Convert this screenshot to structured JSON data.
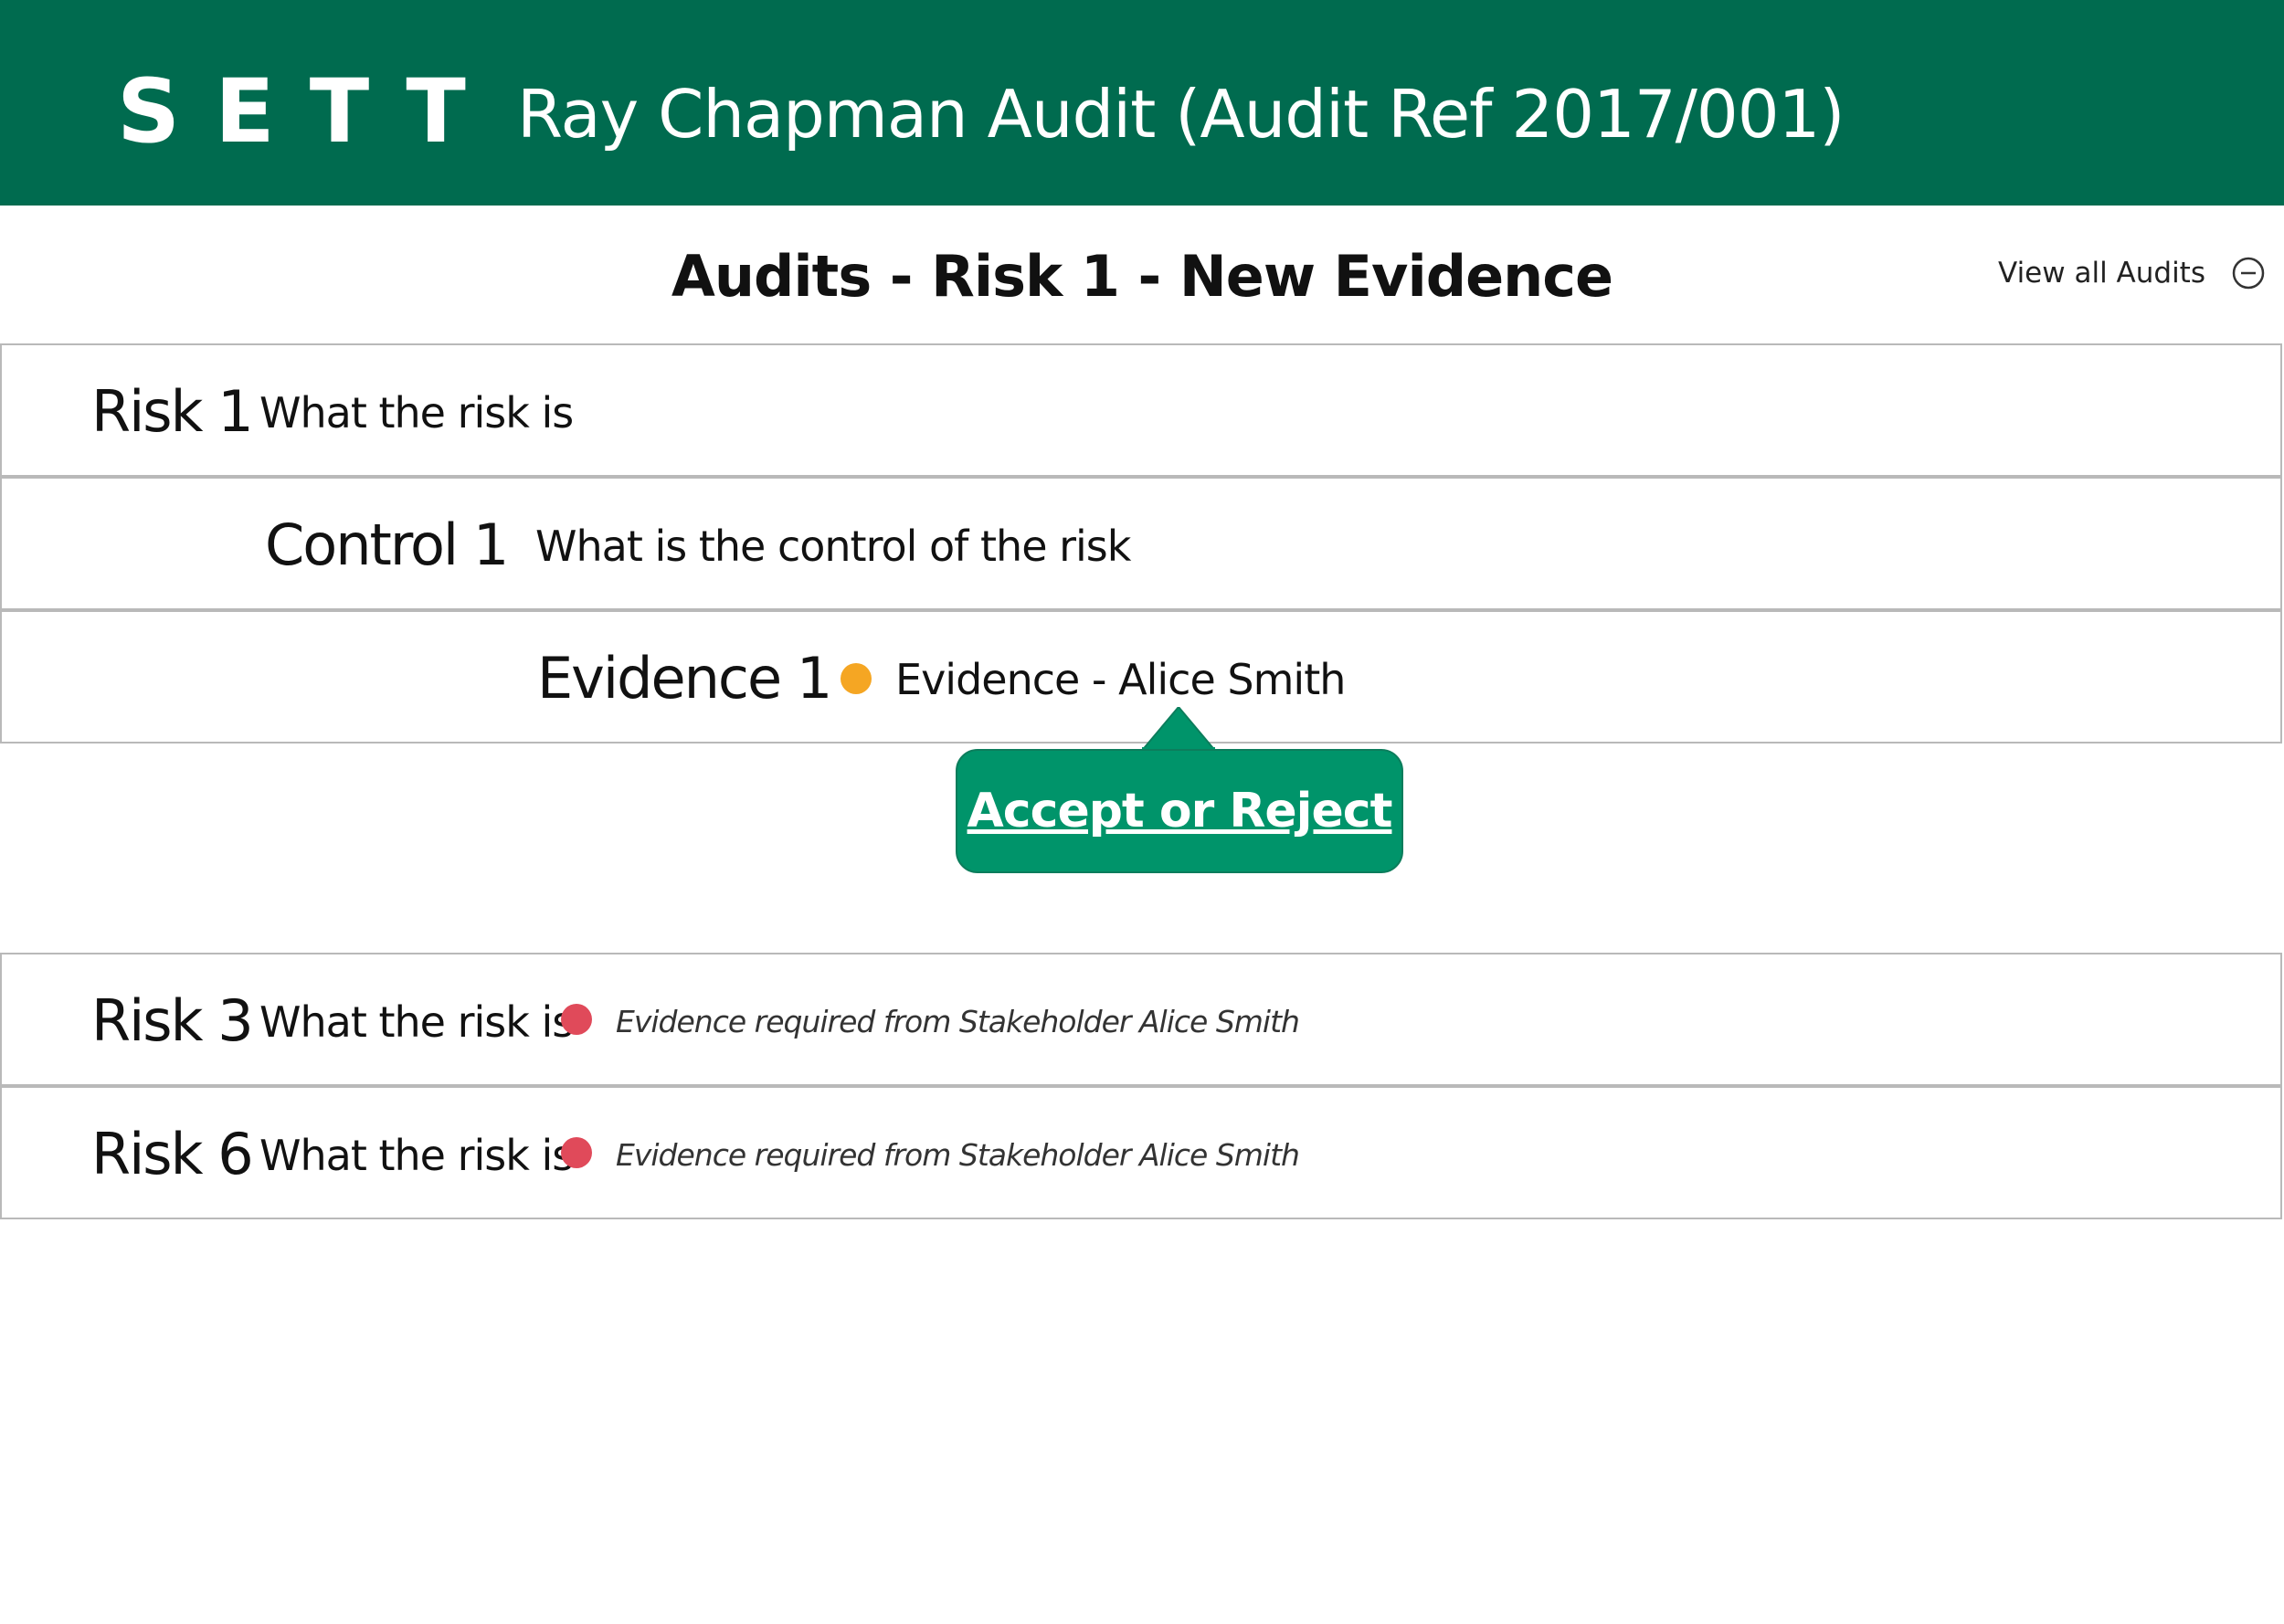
{
  "header": {
    "brand": "SETT",
    "audit_title": "Ray Chapman Audit (Audit Ref 2017/001)",
    "background_color": "#006b4f"
  },
  "page": {
    "title": "Audits - Risk 1 - New Evidence",
    "view_all_label": "View all Audits",
    "view_all_icon": "minus-circle-icon"
  },
  "rows": {
    "risk1": {
      "label": "Risk 1",
      "text": "What the risk is"
    },
    "control1": {
      "label": "Control 1",
      "text": "What is the control of the risk"
    },
    "evidence1": {
      "label": "Evidence 1",
      "status_color": "#f5a623",
      "text": "Evidence - Alice Smith"
    },
    "risk3": {
      "label": "Risk 3",
      "text": "What the risk is",
      "status_color": "#e04a5a",
      "note": "Evidence required from Stakeholder Alice Smith"
    },
    "risk6": {
      "label": "Risk 6",
      "text": "What the risk is",
      "status_color": "#e04a5a",
      "note": "Evidence required from Stakeholder Alice Smith"
    }
  },
  "callout": {
    "label": "Accept or Reject",
    "color": "#00946a"
  }
}
